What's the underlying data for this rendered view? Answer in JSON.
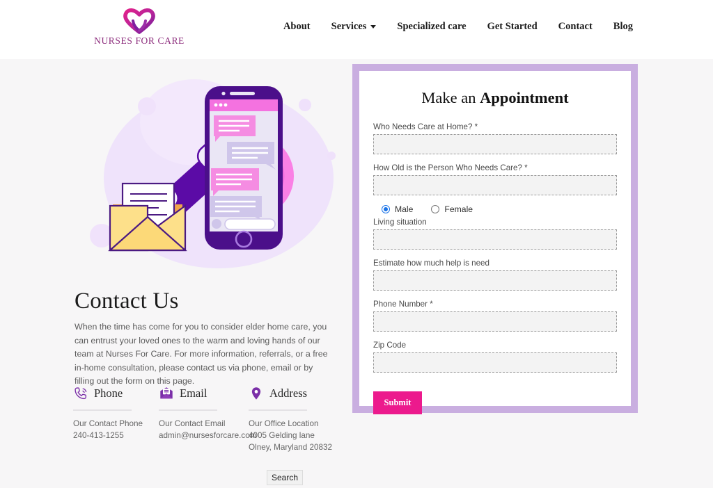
{
  "header": {
    "logo": {
      "icon": "heart-hands-logo-icon",
      "text": "NURSES FOR CARE"
    },
    "nav": [
      {
        "label": "About",
        "has_dropdown": false
      },
      {
        "label": "Services",
        "has_dropdown": true
      },
      {
        "label": "Specialized care",
        "has_dropdown": false
      },
      {
        "label": "Get Started",
        "has_dropdown": false
      },
      {
        "label": "Contact",
        "has_dropdown": false
      },
      {
        "label": "Blog",
        "has_dropdown": false
      }
    ]
  },
  "left": {
    "illustration_name": "contact-communication-illustration",
    "title": "Contact Us",
    "paragraph": "When the time has come for you to consider elder home care, you can entrust your loved ones to the warm and loving hands of our team at Nurses For Care. For more information, referrals, or a free in-home consultation, please contact us via phone, email or by filling out the form on this page.",
    "contacts": [
      {
        "icon": "phone-icon",
        "label": "Phone",
        "caption": "Our Contact Phone",
        "value": "240-413-1255"
      },
      {
        "icon": "envelope-icon",
        "label": "Email",
        "caption": "Our Contact Email",
        "value": "admin@nursesforcare.com"
      },
      {
        "icon": "map-pin-icon",
        "label": "Address",
        "caption": "Our Office Location",
        "value": "4005 Gelding lane Olney, Maryland 20832"
      }
    ]
  },
  "form": {
    "title_light": "Make an ",
    "title_bold": "Appointment",
    "fields": [
      {
        "label": "Who Needs Care at Home? *",
        "value": "",
        "name": "who-needs-care-input"
      },
      {
        "label": "How Old is the Person Who Needs Care? *",
        "value": "",
        "name": "age-input"
      },
      {
        "label": "Living situation",
        "value": "",
        "name": "living-situation-input"
      },
      {
        "label": "Estimate how much help is need",
        "value": "",
        "name": "help-estimate-input"
      },
      {
        "label": "Phone Number *",
        "value": "",
        "name": "phone-number-input"
      },
      {
        "label": "Zip Code",
        "value": "",
        "name": "zip-code-input"
      }
    ],
    "gender": {
      "options": [
        "Male",
        "Female"
      ],
      "selected": "Male"
    },
    "submit_label": "Submit"
  },
  "overlay": {
    "search_label": "Search"
  },
  "colors": {
    "page_background": "#f7f6f7",
    "header_background": "#ffffff",
    "panel_border": "#c9aee0",
    "accent_pink": "#ec1a8d",
    "brand_purple": "#6a0dad",
    "radio_blue": "#1a73e8"
  }
}
